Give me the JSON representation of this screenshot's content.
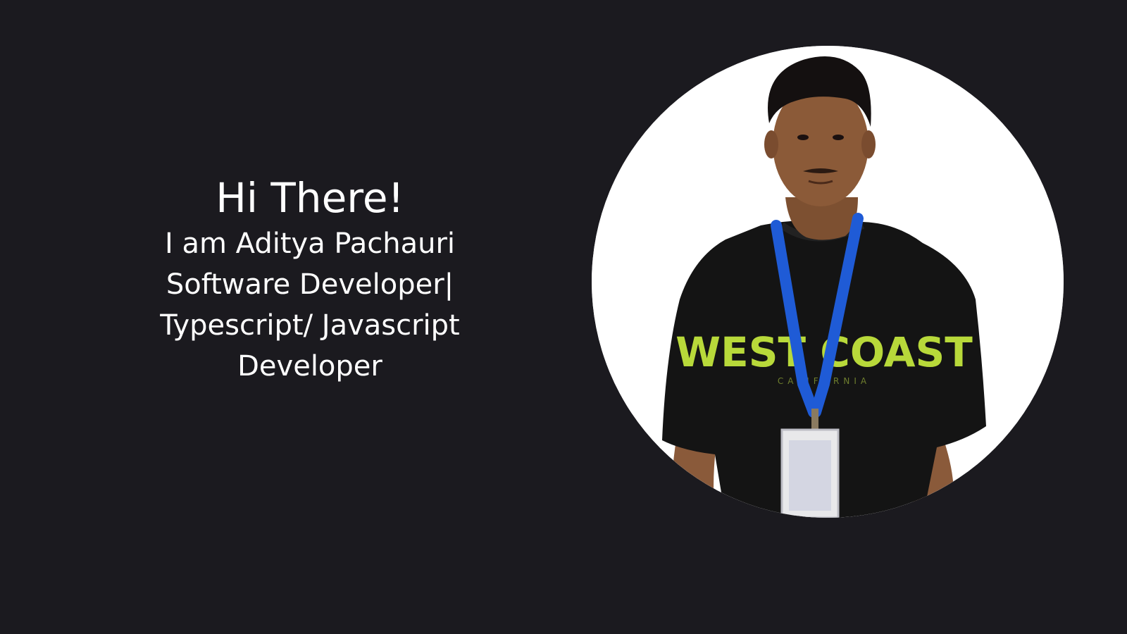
{
  "hero": {
    "greeting": "Hi There!",
    "lines": [
      "I am Aditya Pachauri",
      "Software Developer|",
      "Typescript/ Javascript",
      "Developer"
    ]
  },
  "photo": {
    "shirt_print": "WEST COAST",
    "shirt_subprint": "CALIFORNIA"
  },
  "colors": {
    "background": "#1b1a1f",
    "text": "#ffffff",
    "photo_bg": "#ffffff",
    "lanyard": "#1f5bd6",
    "shirt": "#141414",
    "shirt_print": "#b8d93a"
  }
}
